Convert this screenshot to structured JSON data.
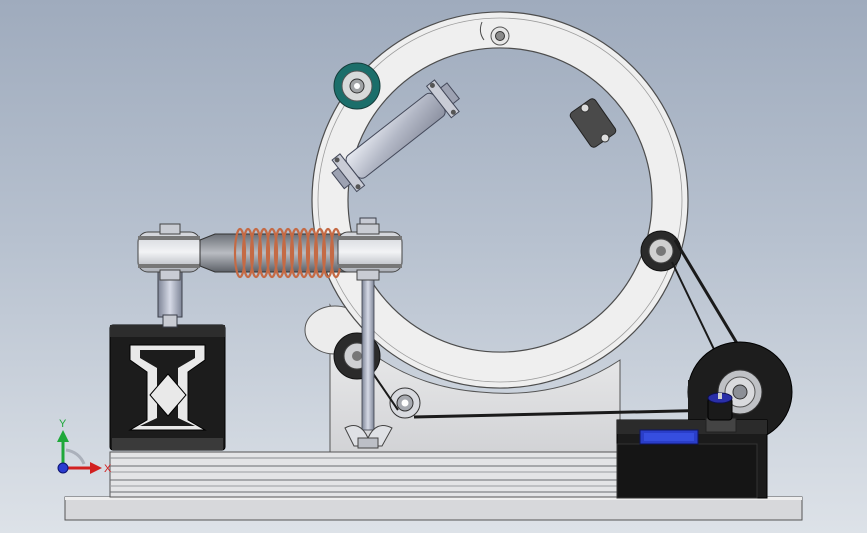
{
  "viewport": {
    "background_top": "#9fabbd",
    "background_bottom": "#dde2e8"
  },
  "triad": {
    "x_label": "X",
    "y_label": "Y",
    "x_color": "#d22020",
    "y_color": "#1fa83a",
    "z_color": "#2a3bd0"
  },
  "components": {
    "spring_color": "#c46a45",
    "idler_accent": "#1b6e6a",
    "knob_color": "#2a2fa8",
    "display_color": "#2a3ec9"
  }
}
